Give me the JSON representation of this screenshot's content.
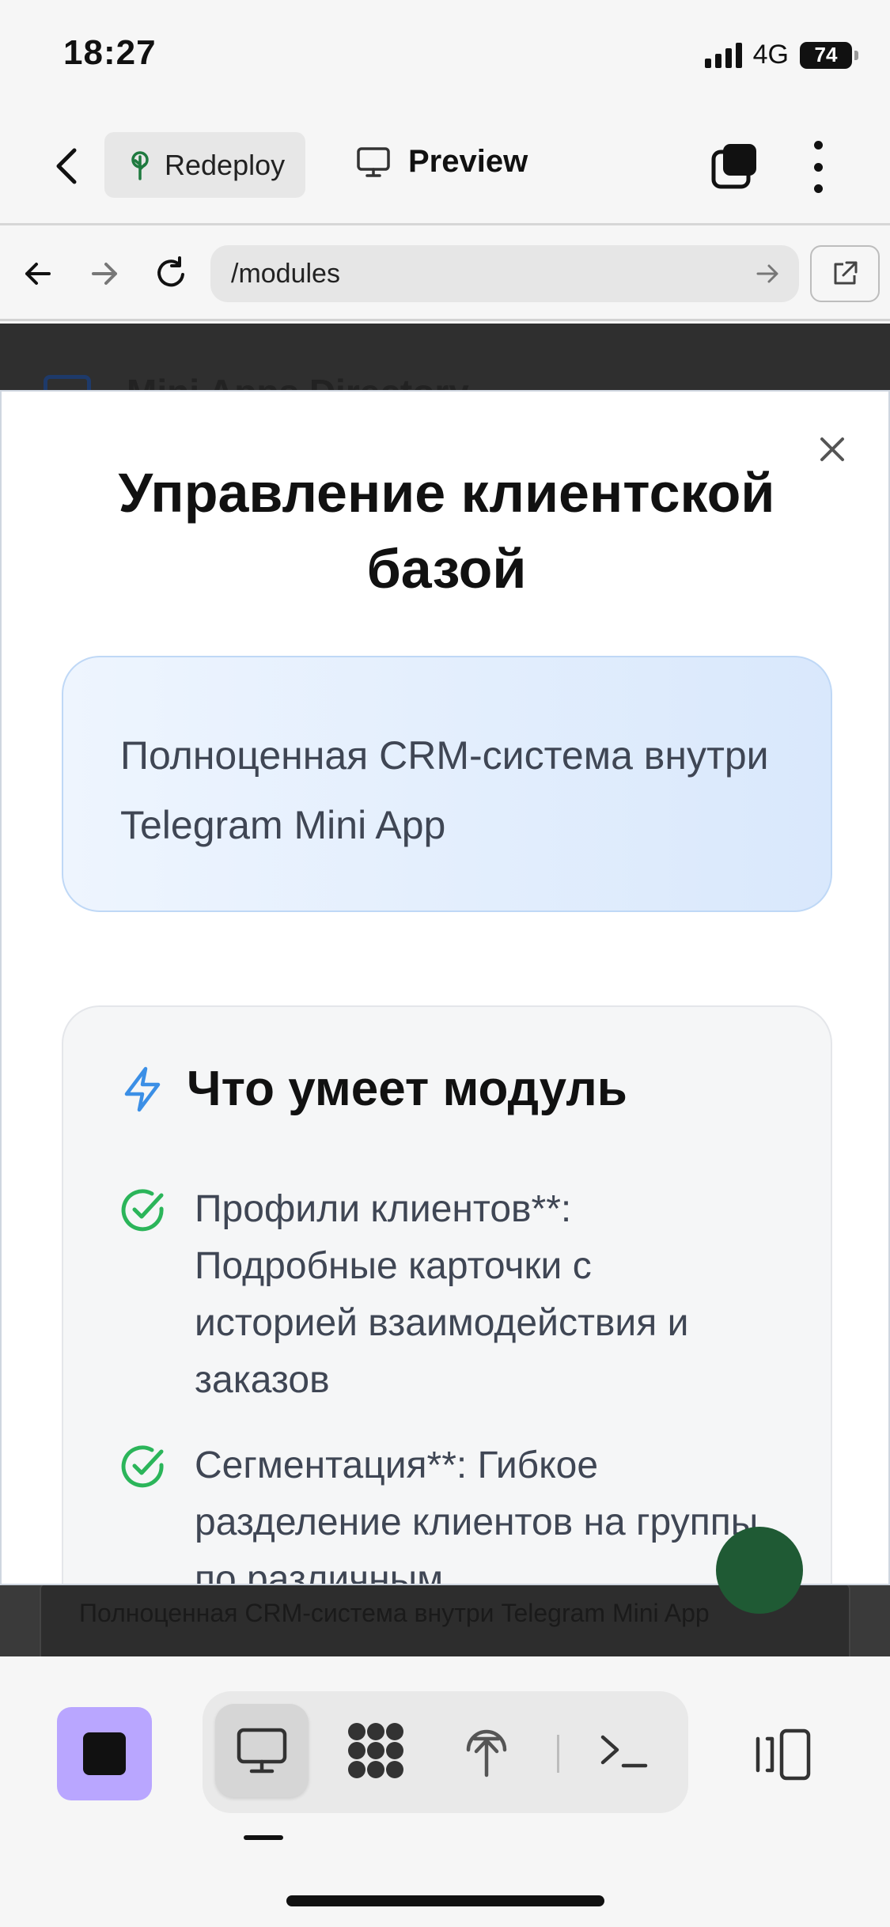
{
  "status_bar": {
    "time": "18:27",
    "network": "4G",
    "battery": "74"
  },
  "app_bar": {
    "redeploy_label": "Redeploy",
    "preview_label": "Preview"
  },
  "browser": {
    "url": "/modules"
  },
  "background_page": {
    "title": "Mini Apps Directory",
    "card_text": "Полноценная CRM-система внутри Telegram Mini App"
  },
  "modal": {
    "title": "Управление клиентской базой",
    "intro": "Полноценная CRM-система внутри Telegram Mini App",
    "features_title": "Что умеет модуль",
    "features": [
      {
        "text": "Профили клиентов**: Подробные карточки с историей взаимодействия и заказов"
      },
      {
        "text": "Сегментация**: Гибкое разделение клиентов на группы по различным"
      }
    ]
  },
  "colors": {
    "accent_purple": "#b9a6ff",
    "check_green": "#2bb55a",
    "bolt_blue": "#3b8fe6",
    "intro_border": "#bfd8f6"
  },
  "icons": {
    "back": "chevron-left-icon",
    "redeploy": "tree-icon",
    "preview": "monitor-icon",
    "tabs": "tabs-icon",
    "more": "more-vertical-icon",
    "nav_back": "arrow-left-icon",
    "nav_forward": "arrow-right-icon",
    "reload": "reload-icon",
    "url_go": "arrow-right-icon",
    "open_external": "external-link-icon",
    "close": "close-icon",
    "features": "bolt-icon",
    "feature_item": "check-circle-icon",
    "toolbar": [
      "stop-icon",
      "monitor-icon",
      "modules-icon",
      "deploy-icon",
      "terminal-icon",
      "panel-icon"
    ]
  }
}
